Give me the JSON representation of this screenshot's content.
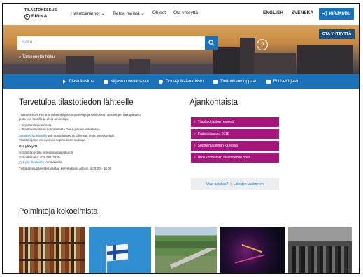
{
  "header": {
    "logo_line1": "TILASTOKESKUS",
    "logo_line2": "FINNA",
    "nav": [
      "Hakutoiminnot ⌄",
      "Tietoa meistä ⌄",
      "Ohjeet",
      "Ota yhteyttä"
    ],
    "lang_en": "ENGLISH",
    "lang_sv": "SVENSKA",
    "login": "KIRJAUDU"
  },
  "hero": {
    "search_placeholder": "Haku...",
    "advanced_search": "Tarkennettu haku",
    "feedback": "OTA YHTEYTTÄ",
    "help": "?"
  },
  "linkbar": [
    "Tilastokeskus",
    "Kirjaston verkkosivut",
    "Doria-julkaisuarkisto",
    "Tiedonhaun oppaat",
    "ELLI-eKirjasto"
  ],
  "welcome": {
    "title": "Tervetuloa tilastotiedon lähteelle",
    "p1_line1": "Tilastokeskus Finna on tilastokirjaston palveluja ja sähköisten aineistojen hakupalvelu,",
    "p1_line2": "josta voit selailla ja etsiä aineistoja:",
    "bullet1": "– kirjaston kokoelmista",
    "bullet2": "– Tilastokeskuksen kokoelmasta Doria-julkaisuarkistossa",
    "p2_link": "Sisäänkirjautumalla",
    "p2_rest": " voit uusia lainasi ja tallentaa omia suosikkejasi.",
    "p3": "Tilastokirjasto on avoinna sopimuksen mukaan.",
    "contact_heading": "Ota yhteyttä:",
    "email": "Sähköpostilla: info@tilastokeskus.fi",
    "phone": "Soittamalla: 029 551 2220",
    "ask": "Kysy tilastoista",
    "ask_rest": " lomakkeella",
    "hours": "Tietopalvelupäivystys vastaa kysymyksiisi arkisin klo 9.00 - 16.00"
  },
  "current": {
    "title": "Ajankohtaista",
    "items": [
      "Tilastokirjaston remontti",
      "Päästötilastoja 2018",
      "Suomi maailman kärjessä",
      "Uusi kotimaisen tilastotiedon opas"
    ],
    "sub_link": "Uusi asiakas?",
    "sub_sep": "|",
    "sub_link2": "Lainojen uusiminen"
  },
  "picks": {
    "title": "Poimintoja kokoelmista"
  },
  "colors": {
    "accent": "#1a73b8",
    "news": "#a5157c"
  }
}
